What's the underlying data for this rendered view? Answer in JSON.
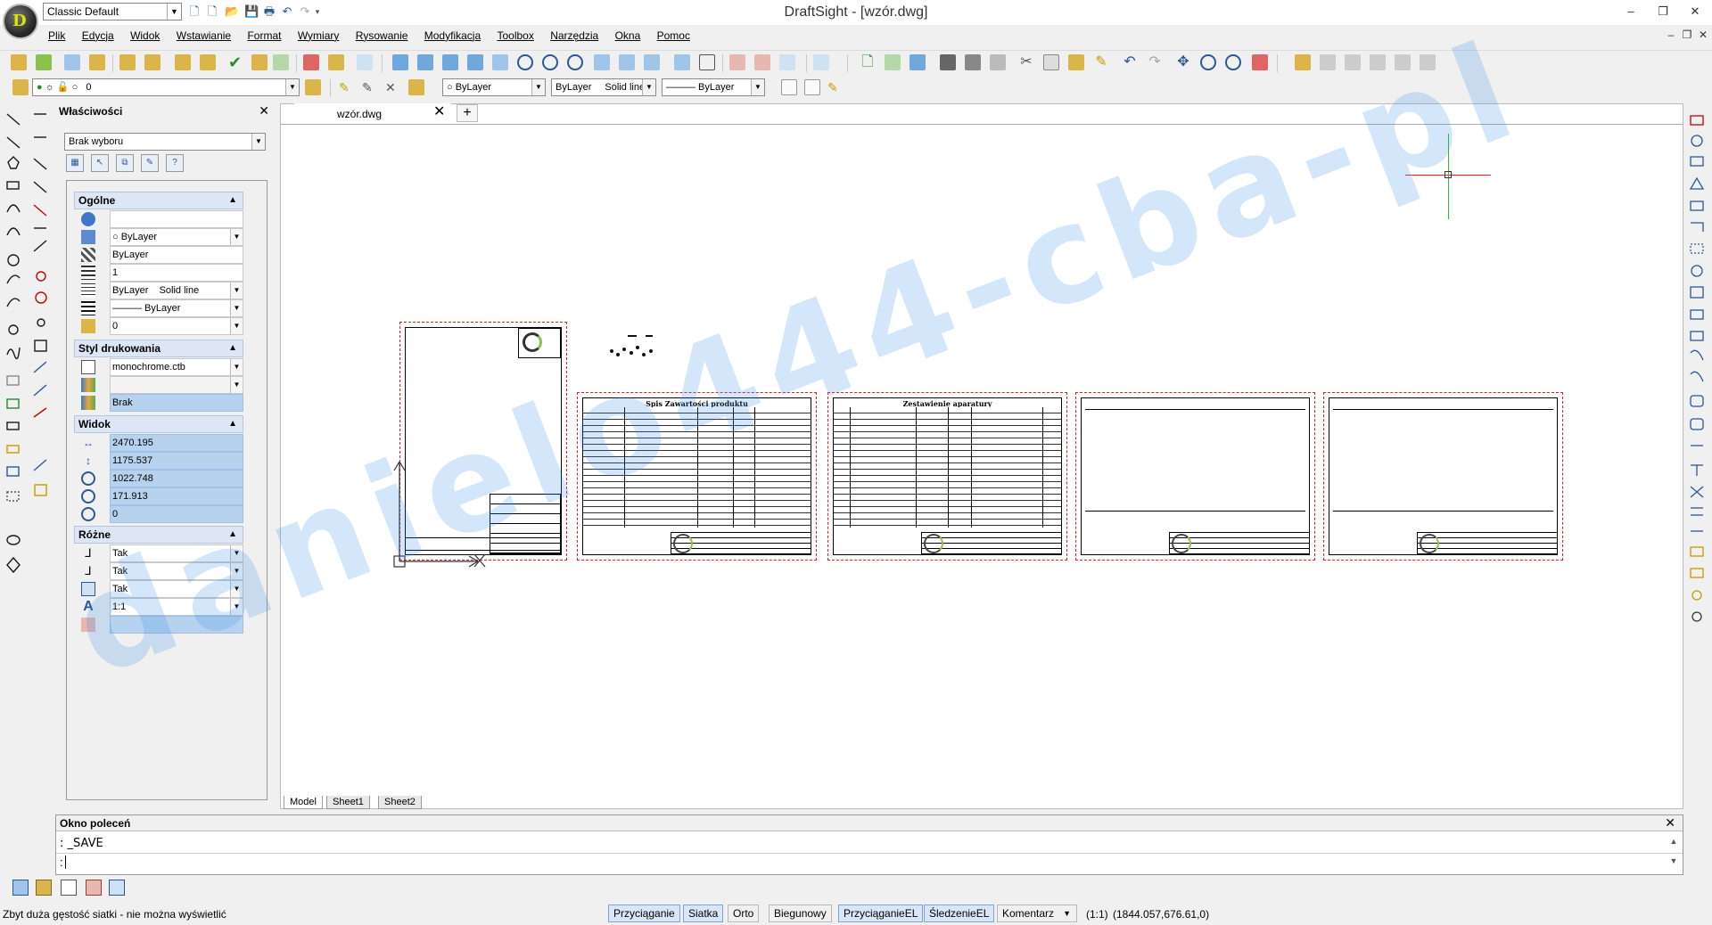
{
  "window": {
    "title": "DraftSight - [wzór.dwg]",
    "workspace": "Classic Default",
    "logo_letter": "D",
    "minimize": "–",
    "restore": "❐",
    "close": "✕"
  },
  "menu": {
    "items": [
      "Plik",
      "Edycja",
      "Widok",
      "Wstawianie",
      "Format",
      "Wymiary",
      "Rysowanie",
      "Modyfikacja",
      "Toolbox",
      "Narzędzia",
      "Okna",
      "Pomoc"
    ]
  },
  "layer_bar": {
    "layer_value": "0",
    "color_value": "ByLayer",
    "linetype_name": "ByLayer",
    "linetype_style": "Solid line",
    "lineweight_value": "——— ByLayer"
  },
  "properties": {
    "title": "Właściwości",
    "selection": "Brak wyboru",
    "sections": {
      "general": "Ogólne",
      "print_style": "Styl drukowania",
      "view": "Widok",
      "misc": "Różne"
    },
    "general": {
      "color": "ByLayer",
      "layer_pattern": "ByLayer",
      "scale": "1",
      "linetype_name": "ByLayer",
      "linetype_style": "Solid line",
      "lineweight": "——— ByLayer",
      "layer": "0"
    },
    "print_style": {
      "table": "monochrome.ctb",
      "none": "Brak"
    },
    "view": {
      "width": "2470.195",
      "height": "1175.537",
      "center_x": "1022.748",
      "center_y": "171.913",
      "center_z": "0"
    },
    "misc": {
      "ucs_icon_on": "Tak",
      "ucs_icon_origin": "Tak",
      "ucs_per_viewport": "Tak",
      "annotation_scale": "1:1"
    }
  },
  "document": {
    "tab_name": "wzór.dwg",
    "layout_tabs": [
      "Model",
      "Sheet1",
      "Sheet2"
    ],
    "sheet_titles": [
      "Spis Zawartości produktu",
      "Zestawienie aparatury"
    ]
  },
  "watermark": "danielo444-cba-pl",
  "command": {
    "title": "Okno poleceń",
    "history": ": _SAVE",
    "prompt": ":"
  },
  "status": {
    "message": "Zbyt duża gęstość siatki - nie można wyświetlić",
    "buttons": [
      {
        "label": "Przyciąganie",
        "on": true
      },
      {
        "label": "Siatka",
        "on": true
      },
      {
        "label": "Orto",
        "on": false
      },
      {
        "label": "Biegunowy",
        "on": false
      },
      {
        "label": "PrzyciąganieEL",
        "on": true
      },
      {
        "label": "ŚledzenieEL",
        "on": true
      }
    ],
    "annotation": "Komentarz",
    "scale": "(1:1)",
    "coordinates": "(1844.057,676.61,0)"
  },
  "colors": {
    "accent": "#2b5797",
    "selected_field": "#b7d2ee",
    "section_header": "#dce6f4",
    "sheet_border": "#e02020",
    "crosshair_x": "#e0242a",
    "crosshair_y": "#2bbf2b"
  }
}
